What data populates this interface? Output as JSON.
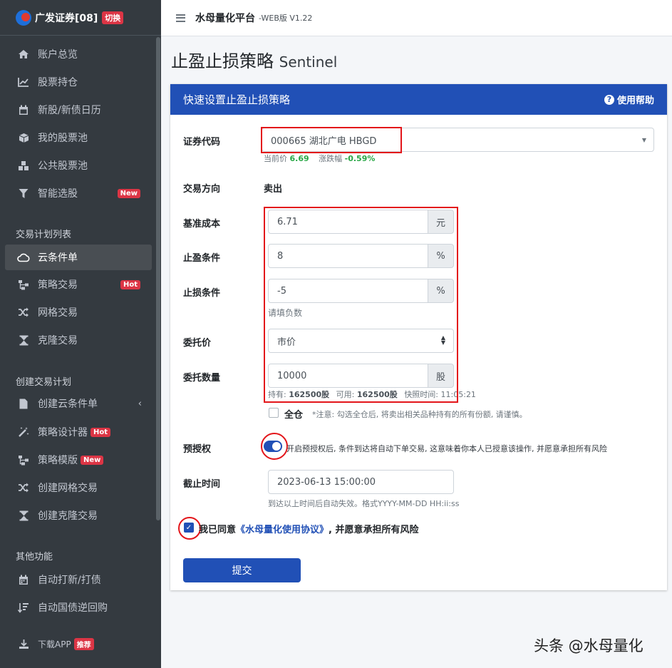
{
  "brand": {
    "name": "广发证券[08]",
    "switch_label": "切换"
  },
  "sidebar": {
    "items": [
      {
        "label": "账户总览",
        "icon": "home-icon"
      },
      {
        "label": "股票持仓",
        "icon": "chart-line-icon"
      },
      {
        "label": "新股/新债日历",
        "icon": "calendar-icon"
      },
      {
        "label": "我的股票池",
        "icon": "cube-icon"
      },
      {
        "label": "公共股票池",
        "icon": "cubes-icon"
      },
      {
        "label": "智能选股",
        "icon": "filter-icon",
        "badge": "New"
      }
    ],
    "section1": "交易计划列表",
    "plan_items": [
      {
        "label": "云条件单",
        "icon": "cloud-icon",
        "active": true
      },
      {
        "label": "策略交易",
        "icon": "sitemap-icon",
        "badge": "Hot"
      },
      {
        "label": "网格交易",
        "icon": "random-icon"
      },
      {
        "label": "克隆交易",
        "icon": "hourglass-icon"
      }
    ],
    "section2": "创建交易计划",
    "create_items": [
      {
        "label": "创建云条件单",
        "icon": "file-icon"
      },
      {
        "label": "策略设计器",
        "icon": "magic-icon",
        "badge": "Hot"
      },
      {
        "label": "策略模版",
        "icon": "sitemap-icon",
        "badge": "New"
      },
      {
        "label": "创建网格交易",
        "icon": "random-icon"
      },
      {
        "label": "创建克隆交易",
        "icon": "hourglass-icon"
      }
    ],
    "section3": "其他功能",
    "other_items": [
      {
        "label": "自动打新/打债",
        "icon": "calendar-icon"
      },
      {
        "label": "自动国债逆回购",
        "icon": "sort-icon"
      }
    ],
    "download": {
      "label": "下载APP",
      "badge": "推荐"
    }
  },
  "topbar": {
    "title": "水母量化平台",
    "version": "-WEB版 V1.22"
  },
  "page": {
    "title": "止盈止损策略",
    "title_en": "Sentinel"
  },
  "card": {
    "header": "快速设置止盈止损策略",
    "help": "使用帮助"
  },
  "form": {
    "code_label": "证券代码",
    "code_value": "000665 湖北广电 HBGD",
    "price_label": "当前价",
    "price_value": "6.69",
    "change_label": "涨跌幅",
    "change_value": "-0.59%",
    "direction_label": "交易方向",
    "direction_value": "卖出",
    "cost_label": "基准成本",
    "cost_value": "6.71",
    "cost_unit": "元",
    "tp_label": "止盈条件",
    "tp_value": "8",
    "tp_unit": "%",
    "sl_label": "止损条件",
    "sl_value": "-5",
    "sl_unit": "%",
    "sl_hint": "请填负数",
    "order_price_label": "委托价",
    "order_price_value": "市价",
    "qty_label": "委托数量",
    "qty_value": "10000",
    "qty_unit": "股",
    "holding_label": "持有:",
    "holding_value": "162500股",
    "avail_label": "可用:",
    "avail_value": "162500股",
    "snapshot_label": "快照时间:",
    "snapshot_value": "11:05:21",
    "all_label": "全仓",
    "all_note": "*注意: 勾选全仓后, 将卖出相关品种持有的所有份额, 请谨慎。",
    "preauth_label": "预授权",
    "preauth_text": "开启预授权后, 条件到达将自动下单交易, 这意味着你本人已授意该操作, 并愿意承担所有风险",
    "deadline_label": "截止时间",
    "deadline_value": "2023-06-13 15:00:00",
    "deadline_hint": "到达以上时间后自动失效。格式YYYY-MM-DD HH:ii:ss",
    "agree_prefix": "我已同意",
    "agree_link": "《水母量化使用协议》",
    "agree_suffix": ", 并愿意承担所有风险",
    "submit": "提交"
  },
  "watermark": "头条 @水母量化",
  "colors": {
    "primary": "#2150b6",
    "sidebar": "#343a40",
    "highlight_red": "#e3151a",
    "change_green": "#28a745"
  }
}
